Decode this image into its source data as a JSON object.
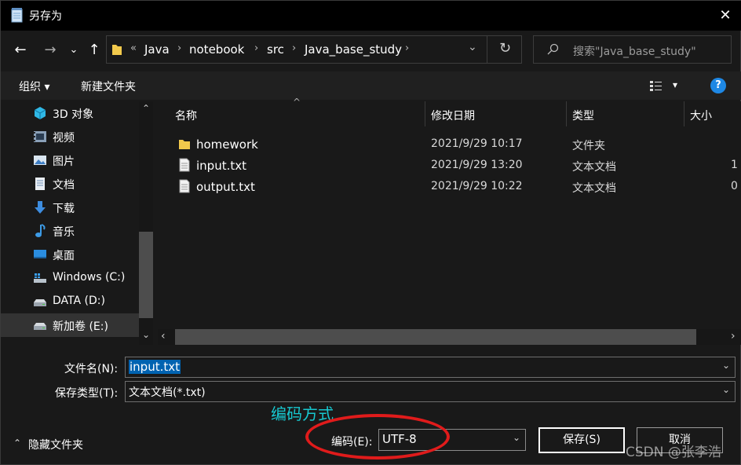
{
  "window": {
    "title": "另存为",
    "close_glyph": "✕"
  },
  "nav": {
    "back": "←",
    "forward": "→",
    "recent": "⌄",
    "up": "↑",
    "refresh": "↻",
    "address_dropdown": "⌄"
  },
  "address": {
    "overflow": "«",
    "crumbs": [
      "Java",
      "notebook",
      "src",
      "Java_base_study"
    ],
    "sep": "›"
  },
  "search": {
    "placeholder": "搜索\"Java_base_study\""
  },
  "toolbar": {
    "organize": "组织 ▾",
    "new_folder": "新建文件夹",
    "view_arrow": "▾",
    "help": "?"
  },
  "sidebar": {
    "items": [
      {
        "label": "3D 对象",
        "icon": "3d-objects-icon"
      },
      {
        "label": "视频",
        "icon": "video-icon"
      },
      {
        "label": "图片",
        "icon": "pictures-icon"
      },
      {
        "label": "文档",
        "icon": "documents-icon"
      },
      {
        "label": "下载",
        "icon": "downloads-icon"
      },
      {
        "label": "音乐",
        "icon": "music-icon"
      },
      {
        "label": "桌面",
        "icon": "desktop-icon"
      },
      {
        "label": "Windows (C:)",
        "icon": "drive-c-icon"
      },
      {
        "label": "DATA (D:)",
        "icon": "drive-d-icon"
      },
      {
        "label": "新加卷 (E:)",
        "icon": "drive-e-icon"
      }
    ],
    "scroll_up": "⌃",
    "scroll_down": "⌄"
  },
  "files": {
    "columns": [
      "名称",
      "修改日期",
      "类型",
      "大小"
    ],
    "sort_indicator": "^",
    "rows": [
      {
        "name": "homework",
        "date": "2021/9/29 10:17",
        "type": "文件夹",
        "size": "",
        "icon": "folder-icon"
      },
      {
        "name": "input.txt",
        "date": "2021/9/29 13:20",
        "type": "文本文档",
        "size": "1",
        "icon": "text-file-icon"
      },
      {
        "name": "output.txt",
        "date": "2021/9/29 10:22",
        "type": "文本文档",
        "size": "0",
        "icon": "text-file-icon"
      }
    ],
    "hscroll_left": "‹",
    "hscroll_right": "›"
  },
  "form": {
    "filename_label": "文件名(N):",
    "filename_value": "input.txt",
    "filetype_label": "保存类型(T):",
    "filetype_value": "文本文档(*.txt)",
    "encoding_label": "编码(E):",
    "encoding_value": "UTF-8",
    "hide_folders": "隐藏文件夹",
    "hide_chevron": "⌃",
    "save": "保存(S)",
    "cancel": "取消",
    "dropdown_chev": "⌄"
  },
  "annotation": {
    "text": "编码方式",
    "color": "#17c8d0",
    "oval_color": "#e01b1b"
  },
  "watermark": "CSDN @张李浩",
  "colors": {
    "background": "#191919",
    "accent": "#0063b1",
    "help": "#1e88e5",
    "folder": "#f2c94c"
  }
}
